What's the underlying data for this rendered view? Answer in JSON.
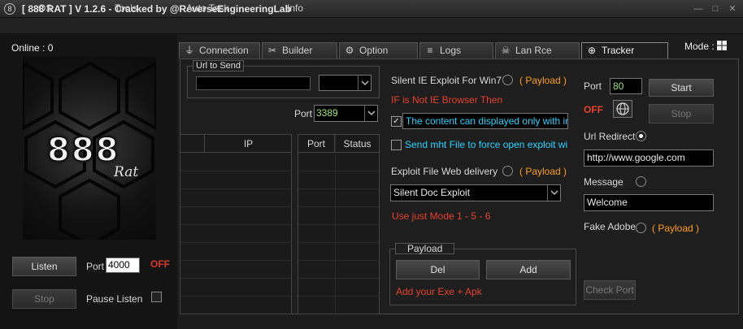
{
  "window": {
    "title": "[ 888 RAT ] V 1.2.6 - Cracked by @ReverseEngineeringLab"
  },
  "menu": [
    "OS",
    "Tools",
    "Auto Task",
    "Info"
  ],
  "left": {
    "online": "Online : 0",
    "logo_main": "888",
    "logo_sub": "Rat",
    "listen_label": "Listen",
    "port_label": "Port",
    "port_value": "4000",
    "status": "OFF",
    "stop_label": "Stop",
    "pause_label": "Pause Listen"
  },
  "tabs": [
    {
      "label": "Connection",
      "icon": "plug-icon"
    },
    {
      "label": "Builder",
      "icon": "tools-icon"
    },
    {
      "label": "Option",
      "icon": "gear-icon"
    },
    {
      "label": "Logs",
      "icon": "database-icon"
    },
    {
      "label": "Lan Rce",
      "icon": "skull-icon"
    },
    {
      "label": "Tracker",
      "icon": "globe-icon"
    }
  ],
  "mode_label": "Mode :",
  "tracker": {
    "url_group_label": "Url to Send",
    "port_label": "Port",
    "port_value": "3389",
    "ip_table": {
      "columns": [
        "",
        "IP"
      ]
    },
    "port_table": {
      "columns": [
        "Port",
        "Status"
      ]
    },
    "silent_ie": "Silent IE Exploit For Win7",
    "payload_tag": "( Payload )",
    "ie_note": "IF is Not IE Browser Then",
    "content_text": "The content can displayed only with internet",
    "mht_text": "Send mht File to force open exploit with IE",
    "exploit_web": "Exploit File Web delivery",
    "exploit_select": "Silent Doc Exploit",
    "mode_note": "Use just Mode 1 - 5 - 6",
    "payload_group": "Payload",
    "del_label": "Del",
    "add_label": "Add",
    "exe_note": "Add your Exe  +  Apk",
    "port_label_right": "Port",
    "port_value_right": "80",
    "start_label": "Start",
    "status": "OFF",
    "stop_label": "Stop",
    "url_redirect": "Url Redirect",
    "url_value": "http://www.google.com",
    "message_label": "Message",
    "message_value": "Welcome",
    "fake_adobe": "Fake Adobe",
    "check_port": "Check Port"
  },
  "colors": {
    "accent_red": "#e8412c",
    "accent_orange": "#ff9e1a",
    "accent_cyan": "#25d5ff",
    "port_green": "#9fe86a"
  }
}
